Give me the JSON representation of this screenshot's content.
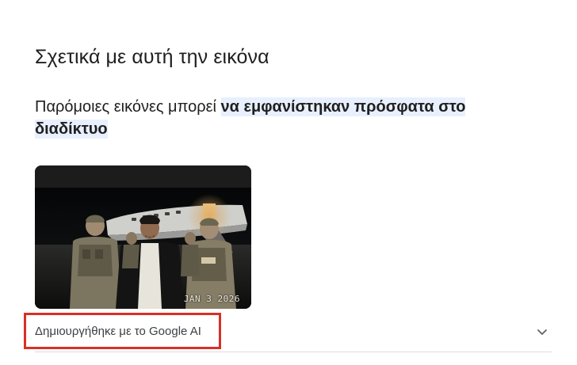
{
  "panel": {
    "title": "Σχετικά με αυτή την εικόνα",
    "description_plain": "Παρόμοιες εικόνες μπορεί ",
    "description_highlight": "να εμφανίστηκαν πρόσφατα στο διαδίκτυο",
    "image": {
      "date_stamp": "JAN 3 2026"
    },
    "ai_label": "Δημιουργήθηκε με το Google AI",
    "expand_icon": "chevron-down-icon"
  },
  "colors": {
    "highlight_bg": "#e8f0fe",
    "annotation_border": "#d93025",
    "divider": "#dadce0"
  }
}
